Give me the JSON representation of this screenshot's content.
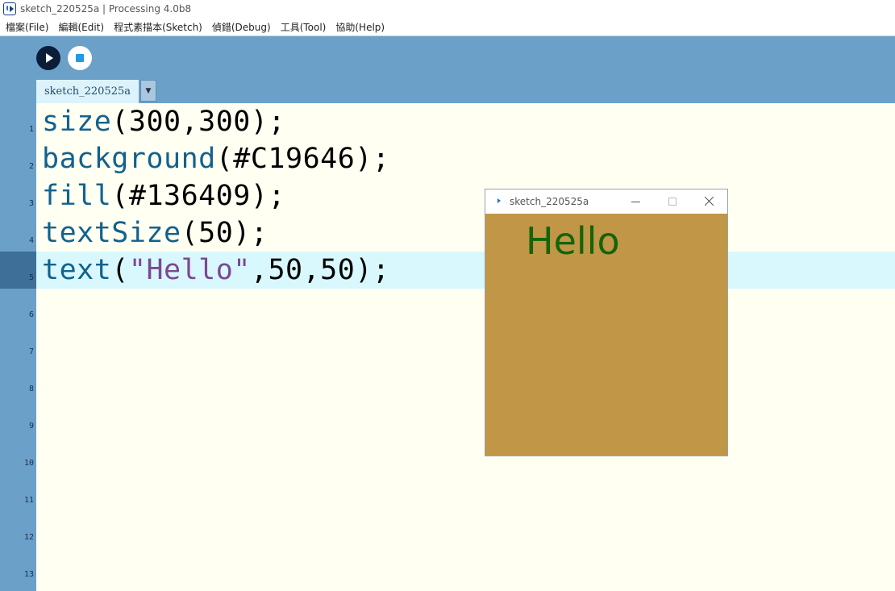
{
  "window": {
    "title": "sketch_220525a | Processing 4.0b8"
  },
  "menubar": {
    "items": [
      "檔案(File)",
      "編輯(Edit)",
      "程式素描本(Sketch)",
      "偵錯(Debug)",
      "工具(Tool)",
      "協助(Help)"
    ]
  },
  "toolbar": {
    "run_icon": "play-icon",
    "stop_icon": "stop-icon",
    "tab_label": "sketch_220525a",
    "tab_menu_glyph": "▼"
  },
  "editor": {
    "active_line": 5,
    "line_numbers": [
      "1",
      "2",
      "3",
      "4",
      "5",
      "6",
      "7",
      "8",
      "9",
      "10",
      "11",
      "12",
      "13"
    ],
    "lines": [
      {
        "parts": [
          {
            "t": "size",
            "k": "kw"
          },
          {
            "t": "(300,300);"
          }
        ]
      },
      {
        "parts": [
          {
            "t": "background",
            "k": "kw"
          },
          {
            "t": "(#C19646);"
          }
        ]
      },
      {
        "parts": [
          {
            "t": "fill",
            "k": "kw"
          },
          {
            "t": "(#136409);"
          }
        ]
      },
      {
        "parts": [
          {
            "t": "textSize",
            "k": "kw"
          },
          {
            "t": "(50);"
          }
        ]
      },
      {
        "parts": [
          {
            "t": "text",
            "k": "kw"
          },
          {
            "t": "("
          },
          {
            "t": "\"Hello\"",
            "k": "str"
          },
          {
            "t": ",50,50);"
          }
        ]
      }
    ]
  },
  "sketch_window": {
    "title": "sketch_220525a",
    "background": "#C19646",
    "fill": "#136409",
    "text": "Hello"
  }
}
